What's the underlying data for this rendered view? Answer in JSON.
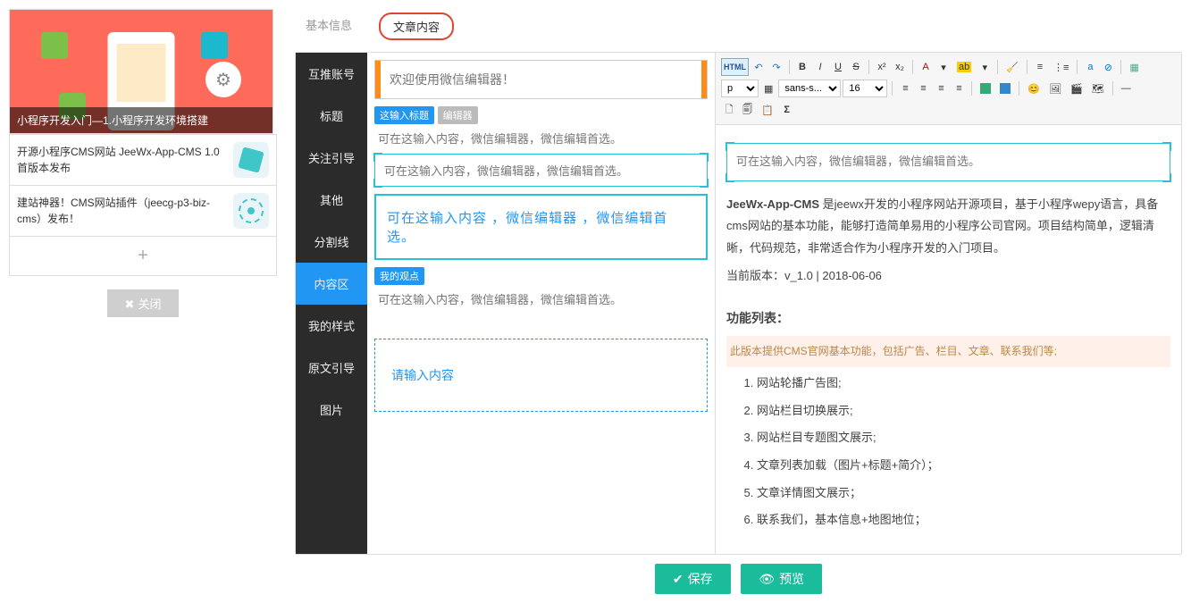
{
  "left": {
    "hero_caption": "小程序开发入门—1.小程序开发环境搭建",
    "cards": [
      "开源小程序CMS网站 JeeWx-App-CMS 1.0 首版本发布",
      "建站神器！CMS网站插件（jeecg-p3-biz-cms）发布！"
    ],
    "close_label": "关闭"
  },
  "tabs": {
    "basic": "基本信息",
    "content": "文章内容"
  },
  "components": [
    "互推账号",
    "标题",
    "关注引导",
    "其他",
    "分割线",
    "内容区",
    "我的样式",
    "原文引导",
    "图片"
  ],
  "preview": {
    "welcome": "欢迎使用微信编辑器！",
    "title_badge": "这输入标题",
    "editor_badge": "编辑器",
    "line1": "可在这输入内容，微信编辑器，微信编辑首选。",
    "framed1": "可在这输入内容，微信编辑器，微信编辑首选。",
    "framed_big": "可在这输入内容 ，微信编辑器 ，微信编辑首选。",
    "viewpoint_badge": "我的观点",
    "viewpoint_line": "可在这输入内容，微信编辑器，微信编辑首选。",
    "input_placeholder": "请输入内容"
  },
  "toolbar": {
    "html": "HTML",
    "para": "p",
    "font": "sans-s...",
    "size": "16"
  },
  "article": {
    "framed": "可在这输入内容，微信编辑器，微信编辑首选。",
    "p1_bold": "JeeWx-App-CMS",
    "p1_rest": " 是jeewx开发的小程序网站开源项目，基于小程序wepy语言，具备cms网站的基本功能，能够打造简单易用的小程序公司官网。项目结构简单，逻辑清晰，代码规范，非常适合作为小程序开发的入门项目。",
    "version_label": "当前版本：v_1.0 | 2018-06-06",
    "features_title": "功能列表：",
    "features_hl": "此版本提供CMS官网基本功能，包括广告、栏目、文章、联系我们等;",
    "features": [
      "网站轮播广告图;",
      "网站栏目切换展示;",
      "网站栏目专题图文展示;",
      "文章列表加载（图片+标题+简介）；",
      "文章详情图文展示；",
      "联系我们，基本信息+地图地位；"
    ]
  },
  "buttons": {
    "save": "保存",
    "preview": "预览"
  }
}
